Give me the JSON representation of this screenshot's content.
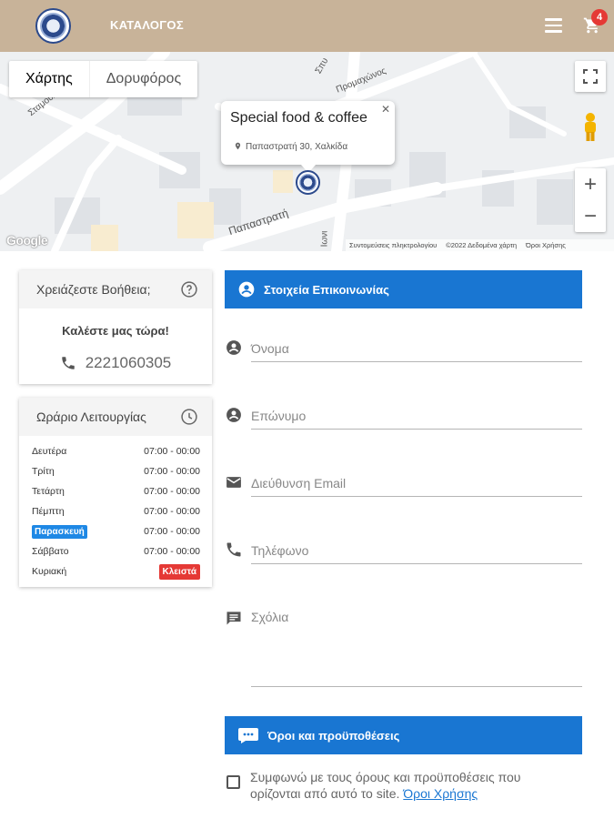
{
  "header": {
    "nav_label": "ΚΑΤΑΛΟΓΟΣ",
    "cart_count": "4",
    "colors": {
      "background": "#c8b399",
      "badge": "#e53935"
    },
    "icons": [
      "logo",
      "hamburger-menu-icon",
      "cart-icon"
    ]
  },
  "map": {
    "tab_map": "Χάρτης",
    "tab_satellite": "Δορυφόρος",
    "info_title": "Special food & coffee",
    "info_address": "Παπαστρατή 30, Χαλκίδα",
    "google": "Google",
    "footer": [
      "Συντομεύσεις πληκτρολογίου",
      "©2022 Δεδομένα χάρτη",
      "Όροι Χρήσης"
    ],
    "streets": {
      "s1": "Σταμούλη",
      "s2": "Προμαχώνος",
      "s3": "Σπυ",
      "s4": "Παπαστρατή",
      "s5": "Ιωνι"
    },
    "zoom_in": "+",
    "zoom_out": "−"
  },
  "help": {
    "title": "Χρειάζεστε Βοήθεια;",
    "call_now": "Καλέστε μας τώρα!",
    "phone": "2221060305"
  },
  "hours": {
    "title": "Ωράριο Λειτουργίας",
    "rows": [
      {
        "day": "Δευτέρα",
        "time": "07:00 - 00:00"
      },
      {
        "day": "Τρίτη",
        "time": "07:00 - 00:00"
      },
      {
        "day": "Τετάρτη",
        "time": "07:00 - 00:00"
      },
      {
        "day": "Πέμπτη",
        "time": "07:00 - 00:00"
      },
      {
        "day": "Παρασκευή",
        "time": "07:00 - 00:00"
      },
      {
        "day": "Σάββατο",
        "time": "07:00 - 00:00"
      },
      {
        "day": "Κυριακή",
        "time": "Κλειστά"
      }
    ],
    "colors": {
      "today": "#1e88e5",
      "closed": "#e53935"
    }
  },
  "contact": {
    "title": "Στοιχεία Επικοινωνίας",
    "color": "#1976d2",
    "fields": {
      "first_name": "Όνομα",
      "last_name": "Επώνυμο",
      "email": "Διεύθυνση Email",
      "phone": "Τηλέφωνο",
      "comments": "Σχόλια"
    }
  },
  "terms": {
    "title": "Όροι και προϋποθέσεις",
    "agree_text": "Συμφωνώ με τους όρους και προϋποθέσεις που ορίζονται από αυτό το site.",
    "link_text": "Όροι Χρήσης"
  }
}
